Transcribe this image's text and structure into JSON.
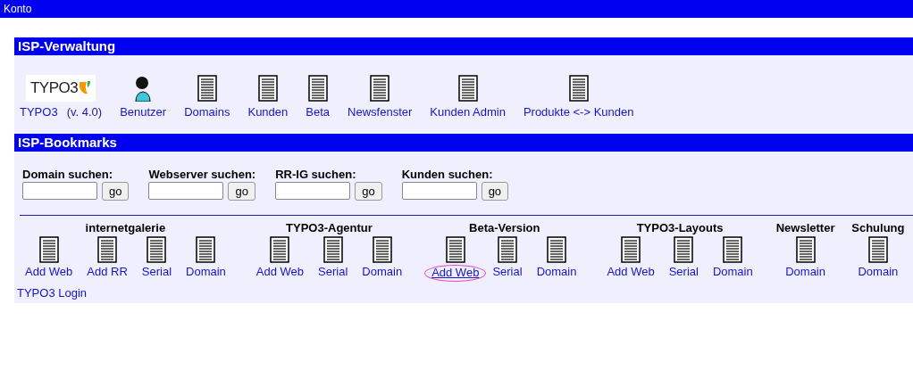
{
  "top_bar": {
    "title": "Konto"
  },
  "verwaltung": {
    "title": "ISP-Verwaltung",
    "items": [
      {
        "kind": "logo",
        "logo_text": "TYPO3",
        "label": "TYPO3",
        "note": "(v. 4.0)"
      },
      {
        "kind": "person",
        "label": "Benutzer"
      },
      {
        "kind": "document",
        "label": "Domains"
      },
      {
        "kind": "document",
        "label": "Kunden"
      },
      {
        "kind": "document",
        "label": "Beta"
      },
      {
        "kind": "document",
        "label": "Newsfenster"
      },
      {
        "kind": "document",
        "label": "Kunden Admin"
      },
      {
        "kind": "document",
        "label": "Produkte <-> Kunden"
      }
    ]
  },
  "bookmarks": {
    "title": "ISP-Bookmarks",
    "searches": [
      {
        "label": "Domain suchen:",
        "button": "go"
      },
      {
        "label": "Webserver suchen:",
        "button": "go"
      },
      {
        "label": "RR-IG suchen:",
        "button": "go"
      },
      {
        "label": "Kunden suchen:",
        "button": "go"
      }
    ],
    "groups": [
      {
        "title": "internetgalerie",
        "links": [
          {
            "label": "Add Web",
            "highlighted": false
          },
          {
            "label": "Add RR",
            "highlighted": false
          },
          {
            "label": "Serial",
            "highlighted": false
          },
          {
            "label": "Domain",
            "highlighted": false
          }
        ]
      },
      {
        "title": "TYPO3-Agentur",
        "links": [
          {
            "label": "Add Web",
            "highlighted": false
          },
          {
            "label": "Serial",
            "highlighted": false
          },
          {
            "label": "Domain",
            "highlighted": false
          }
        ]
      },
      {
        "title": "Beta-Version",
        "links": [
          {
            "label": "Add Web",
            "highlighted": true
          },
          {
            "label": "Serial",
            "highlighted": false
          },
          {
            "label": "Domain",
            "highlighted": false
          }
        ]
      },
      {
        "title": "TYPO3-Layouts",
        "links": [
          {
            "label": "Add Web",
            "highlighted": false
          },
          {
            "label": "Serial",
            "highlighted": false
          },
          {
            "label": "Domain",
            "highlighted": false
          }
        ]
      },
      {
        "title": "Newsletter",
        "links": [
          {
            "label": "Domain",
            "highlighted": false
          }
        ]
      },
      {
        "title": "Schulung",
        "links": [
          {
            "label": "Domain",
            "highlighted": false
          }
        ]
      }
    ],
    "footer_link": "TYPO3 Login"
  }
}
